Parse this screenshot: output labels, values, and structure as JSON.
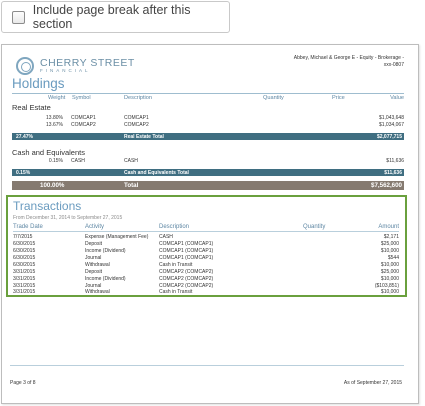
{
  "option": {
    "label": "Include page break after this section",
    "checked": false
  },
  "header": {
    "logo_name": "CHERRY STREET",
    "logo_sub": "FINANCIAL",
    "account_line1": "Abbey, Michael & George E - Equity - Brokerage -",
    "account_line2": "xxx-0807"
  },
  "holdings": {
    "title": "Holdings",
    "columns": {
      "weight": "Weight",
      "symbol": "Symbol",
      "description": "Description",
      "quantity": "Quantity",
      "price": "Price",
      "value": "Value"
    },
    "groups": [
      {
        "name": "Real Estate",
        "rows": [
          {
            "weight": "13.80%",
            "symbol": "COMCAP1",
            "description": "COMCAP1",
            "value": "$1,043,648"
          },
          {
            "weight": "13.67%",
            "symbol": "COMCAP2",
            "description": "COMCAP2",
            "value": "$1,034,067"
          }
        ],
        "total": {
          "weight": "27.47%",
          "label": "Real Estate Total",
          "value": "$2,077,715"
        }
      },
      {
        "name": "Cash and Equivalents",
        "rows": [
          {
            "weight": "0.15%",
            "symbol": "CASH",
            "description": "CASH",
            "value": "$11,636"
          }
        ],
        "total": {
          "weight": "0.15%",
          "label": "Cash and Equivalents Total",
          "value": "$11,636"
        }
      }
    ],
    "grand_total": {
      "weight": "100.00%",
      "label": "Total",
      "value": "$7,562,600"
    }
  },
  "transactions": {
    "title": "Transactions",
    "date_range": "From December 31, 2014 to September 27, 2015",
    "columns": {
      "trade_date": "Trade Date",
      "activity": "Activity",
      "description": "Description",
      "quantity": "Quantity",
      "amount": "Amount"
    },
    "rows": [
      {
        "date": "7/7/2015",
        "activity": "Expense (Management Fee)",
        "description": "CASH",
        "amount": "$2,171"
      },
      {
        "date": "6/30/2015",
        "activity": "Deposit",
        "description": "COMCAP1 (COMCAP1)",
        "amount": "$25,000"
      },
      {
        "date": "6/30/2015",
        "activity": "Income (Dividend)",
        "description": "COMCAP1 (COMCAP1)",
        "amount": "$10,000"
      },
      {
        "date": "6/30/2015",
        "activity": "Journal",
        "description": "COMCAP1 (COMCAP1)",
        "amount": "$544"
      },
      {
        "date": "6/30/2015",
        "activity": "Withdrawal",
        "description": "Cash in Transit",
        "amount": "$10,000"
      },
      {
        "date": "3/31/2015",
        "activity": "Deposit",
        "description": "COMCAP2 (COMCAP2)",
        "amount": "$25,000"
      },
      {
        "date": "3/31/2015",
        "activity": "Income (Dividend)",
        "description": "COMCAP2 (COMCAP2)",
        "amount": "$10,000"
      },
      {
        "date": "3/31/2015",
        "activity": "Journal",
        "description": "COMCAP2 (COMCAP2)",
        "amount": "($103,851)"
      },
      {
        "date": "3/31/2015",
        "activity": "Withdrawal",
        "description": "Cash in Transit",
        "amount": "$10,000"
      }
    ]
  },
  "footer": {
    "page": "Page 3 of 8",
    "as_of": "As of September 27, 2015"
  },
  "colors": {
    "accent_blue": "#6a9bbf",
    "total_bar": "#3f6e81",
    "grand_total_bar": "#857a70",
    "highlight_border": "#6aa03d"
  }
}
